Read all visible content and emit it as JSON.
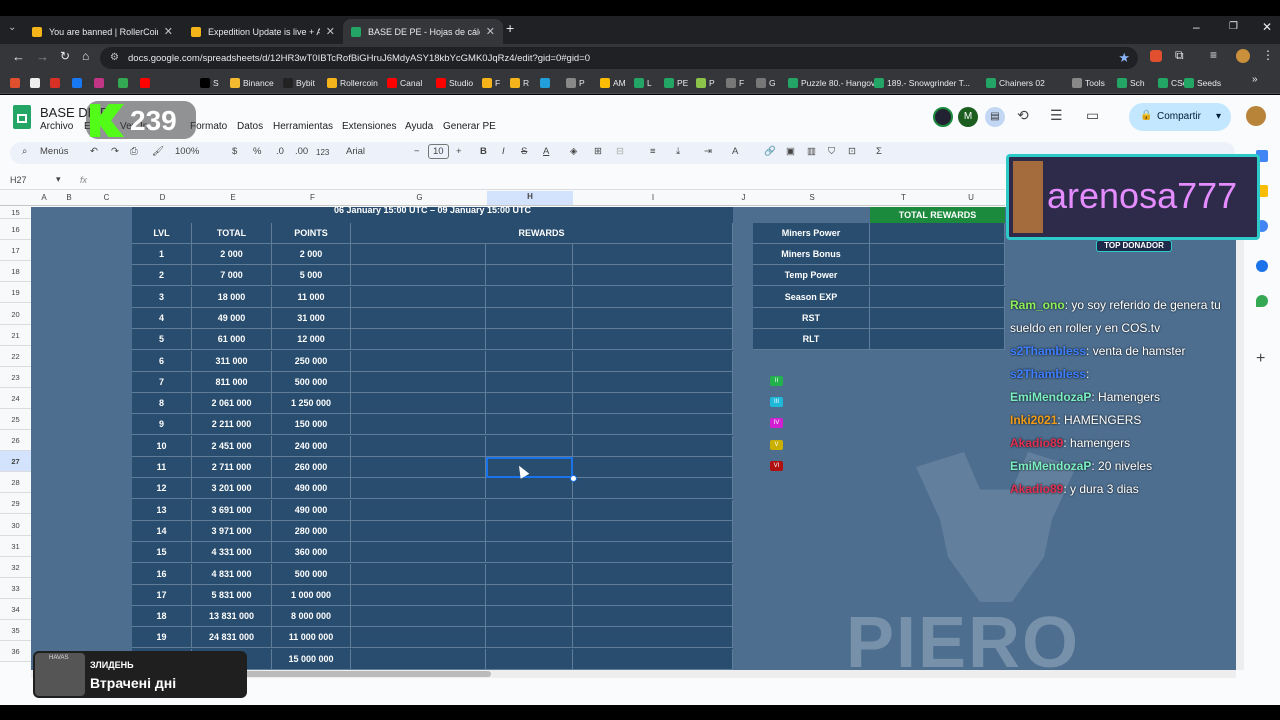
{
  "browser": {
    "tabs": [
      {
        "title": "You are banned | RollerCoin.com",
        "color": "#f6b41b",
        "active": false
      },
      {
        "title": "Expedition Update is live + Adv",
        "color": "#f6b41b",
        "active": false
      },
      {
        "title": "BASE DE PE - Hojas de cálculo de",
        "color": "#23a566",
        "active": true
      }
    ],
    "url": "docs.google.com/spreadsheets/d/12HR3wT0IBTcRofBiGHruJ6MdyASY18kbYcGMK0JqRz4/edit?gid=0#gid=0",
    "bookmarks": [
      "",
      "",
      "",
      "",
      "",
      "",
      "",
      "S",
      "Binance",
      "Bybit",
      "Rollercoin",
      "Canal",
      "Studio",
      "F",
      "R",
      "",
      "P",
      "AM",
      "L",
      "PE",
      "P",
      "F",
      "G",
      "Puzzle 80.- Hangover",
      "189.- Snowgrinder T...",
      "Chainers 02",
      "Tools",
      "Sch",
      "CSch",
      "Seeds"
    ]
  },
  "sheets": {
    "title": "BASE DE P",
    "menus": [
      "Archivo",
      "Ed",
      "Ver",
      "In",
      "Formato",
      "Datos",
      "Herramientas",
      "Extensiones",
      "Ayuda",
      "Generar PE"
    ],
    "share": "Compartir",
    "avatar_letter": "M",
    "overlay_counter": "239",
    "toolbar": {
      "menus": "Menús",
      "zoom": "100%",
      "currency": "$",
      "percent": "%",
      "dec_less": ".0",
      "dec_more": ".00",
      "number": "123",
      "font": "Arial",
      "font_size": "10",
      "bold": "B",
      "italic": "I",
      "underline": "A",
      "sum": "Σ"
    },
    "name_box": "H27",
    "fx": "fx",
    "columns": [
      "A",
      "B",
      "C",
      "D",
      "E",
      "F",
      "G",
      "H",
      "I",
      "J",
      "S",
      "T",
      "U"
    ],
    "rows": [
      "15",
      "16",
      "17",
      "18",
      "19",
      "20",
      "21",
      "22",
      "23",
      "24",
      "25",
      "26",
      "27",
      "28",
      "29",
      "30",
      "31",
      "32",
      "33",
      "34",
      "35",
      "36"
    ],
    "date_range": "06 January 15:00 UTC – 09 January 15:00 UTC",
    "headers": [
      "LVL",
      "TOTAL",
      "POINTS",
      "REWARDS"
    ],
    "levels": [
      {
        "lvl": "1",
        "total": "2 000",
        "points": "2 000"
      },
      {
        "lvl": "2",
        "total": "7 000",
        "points": "5 000"
      },
      {
        "lvl": "3",
        "total": "18 000",
        "points": "11 000"
      },
      {
        "lvl": "4",
        "total": "49 000",
        "points": "31 000"
      },
      {
        "lvl": "5",
        "total": "61 000",
        "points": "12 000"
      },
      {
        "lvl": "6",
        "total": "311 000",
        "points": "250 000"
      },
      {
        "lvl": "7",
        "total": "811 000",
        "points": "500 000"
      },
      {
        "lvl": "8",
        "total": "2 061 000",
        "points": "1 250 000"
      },
      {
        "lvl": "9",
        "total": "2 211 000",
        "points": "150 000"
      },
      {
        "lvl": "10",
        "total": "2 451 000",
        "points": "240 000"
      },
      {
        "lvl": "11",
        "total": "2 711 000",
        "points": "260 000"
      },
      {
        "lvl": "12",
        "total": "3 201 000",
        "points": "490 000"
      },
      {
        "lvl": "13",
        "total": "3 691 000",
        "points": "490 000"
      },
      {
        "lvl": "14",
        "total": "3 971 000",
        "points": "280 000"
      },
      {
        "lvl": "15",
        "total": "4 331 000",
        "points": "360 000"
      },
      {
        "lvl": "16",
        "total": "4 831 000",
        "points": "500 000"
      },
      {
        "lvl": "17",
        "total": "5 831 000",
        "points": "1 000 000"
      },
      {
        "lvl": "18",
        "total": "13 831 000",
        "points": "8 000 000"
      },
      {
        "lvl": "19",
        "total": "24 831 000",
        "points": "11 000 000"
      },
      {
        "lvl": "",
        "total": "000",
        "points": "15 000 000"
      }
    ],
    "total_rewards": "TOTAL REWARDS",
    "reward_labels": [
      "Miners Power",
      "Miners Bonus",
      "Temp Power",
      "Season EXP",
      "RST",
      "RLT"
    ],
    "roman_badges": [
      "II",
      "III",
      "IV",
      "V",
      "VI"
    ],
    "roman_colors": [
      "#22b14c",
      "#1eb9d8",
      "#d21fd2",
      "#c9b000",
      "#b01010"
    ]
  },
  "stream": {
    "donor_name": "arenosa777",
    "donor_badge": "TOP DONADOR",
    "watermark": "PIERO",
    "chat": [
      {
        "nick": "Ram_ono",
        "msg": ": yo soy referido de genera tu sueldo en roller y en COS.tv",
        "color": "#8ef05a"
      },
      {
        "nick": "s2Thambless",
        "msg": ": venta de hamster",
        "color": "#3d7fff"
      },
      {
        "nick": "s2Thambless",
        "msg": ":",
        "color": "#3d7fff"
      },
      {
        "nick": "EmiMendozaP",
        "msg": ": Hamengers",
        "color": "#7cf0c3"
      },
      {
        "nick": "Inki2021",
        "msg": ": HAMENGERS",
        "color": "#f29d18"
      },
      {
        "nick": "Akadio89",
        "msg": ": hamengers",
        "color": "#e03053"
      },
      {
        "nick": "EmiMendozaP",
        "msg": ": 20 niveles",
        "color": "#7cf0c3"
      },
      {
        "nick": "Akadio89",
        "msg": ": y dura 3 dias",
        "color": "#e03053"
      }
    ]
  },
  "notification": {
    "title": "ЗЛИДЕНЬ",
    "message": "Втрачені дні",
    "logo": "HAVAS"
  }
}
